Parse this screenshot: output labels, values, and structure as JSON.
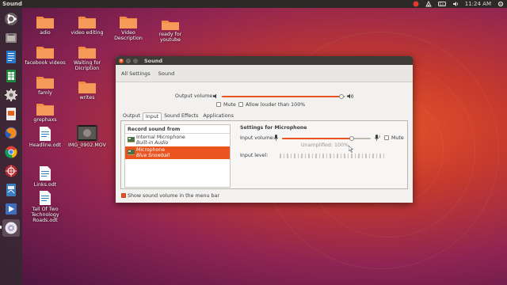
{
  "top_panel": {
    "app_title": "Sound",
    "clock": "11:24 AM",
    "tray_icons": [
      "record-indicator",
      "network-icon",
      "keyboard-icon",
      "volume-icon",
      "power-gear-icon"
    ]
  },
  "launcher": {
    "items": [
      "dash-icon",
      "files-icon",
      "text-editor-icon",
      "settings-icon",
      "writer-icon",
      "firefox-icon",
      "chrome-icon",
      "screen-recorder-icon",
      "calc-icon",
      "impress-icon",
      "dvd-icon"
    ]
  },
  "desktop": {
    "icons": [
      {
        "label": "adio",
        "kind": "folder"
      },
      {
        "label": "video editing",
        "kind": "folder"
      },
      {
        "label": "Video Description",
        "kind": "folder"
      },
      {
        "label": "ready for youtube",
        "kind": "folder"
      },
      {
        "label": "facebook videos",
        "kind": "folder"
      },
      {
        "label": "Waiting for Dicription",
        "kind": "folder"
      },
      {
        "label": "famly",
        "kind": "folder"
      },
      {
        "label": "writes",
        "kind": "folder"
      },
      {
        "label": "grephaxs",
        "kind": "folder"
      },
      {
        "label": "Headline.odt",
        "kind": "document"
      },
      {
        "label": "IMG_0902.MOV",
        "kind": "video"
      },
      {
        "label": "Links.odt",
        "kind": "document"
      },
      {
        "label": "Tall Of Two Technology Roads.odt",
        "kind": "document"
      }
    ]
  },
  "window": {
    "title": "Sound",
    "toolbar": {
      "all_settings": "All Settings",
      "breadcrumb": "Sound"
    },
    "output_volume": {
      "label": "Output volume:",
      "level": 0.97,
      "mute_label": "Mute",
      "allow_louder_label": "Allow louder than 100%"
    },
    "tabs": [
      "Output",
      "Input",
      "Sound Effects",
      "Applications"
    ],
    "active_tab": "Input",
    "record": {
      "heading": "Record sound from",
      "devices": [
        {
          "name": "Internal Microphone",
          "sub": "Built-in Audio",
          "selected": false
        },
        {
          "name": "Microphone",
          "sub": "Blue Snowball",
          "selected": true
        }
      ]
    },
    "settings": {
      "heading": "Settings for Microphone",
      "input_volume_label": "Input volume:",
      "input_volume_level": 0.79,
      "unamplified_label": "Unamplified: 100%",
      "mute_label": "Mute",
      "input_level_label": "Input level:"
    },
    "footer": {
      "show_volume_label": "Show sound volume in the menu bar",
      "checked": true
    }
  },
  "colors": {
    "accent": "#e95420",
    "panel": "#2b2a29",
    "titlebar": "#3c3b37",
    "window_bg": "#f2f1f0"
  }
}
